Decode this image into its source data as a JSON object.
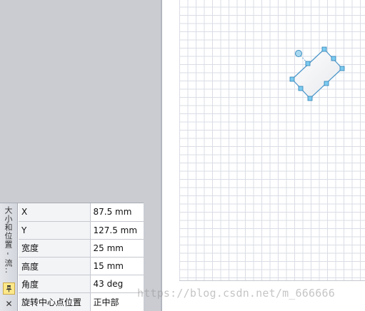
{
  "panel": {
    "title": "大小和位置 - 流...",
    "pin_icon": "pin-icon",
    "close_label": "✕",
    "rows": [
      {
        "label": "X",
        "value": "87.5 mm"
      },
      {
        "label": "Y",
        "value": "127.5 mm"
      },
      {
        "label": "宽度",
        "value": "25 mm"
      },
      {
        "label": "高度",
        "value": "15 mm"
      },
      {
        "label": "角度",
        "value": "43 deg"
      },
      {
        "label": "旋转中心点位置",
        "value": "正中部"
      }
    ]
  },
  "watermark": "https://blog.csdn.net/m_666666",
  "colors": {
    "handle": "#5db8e0",
    "shape_outline": "#4a95c9",
    "background": "#caccd2"
  }
}
